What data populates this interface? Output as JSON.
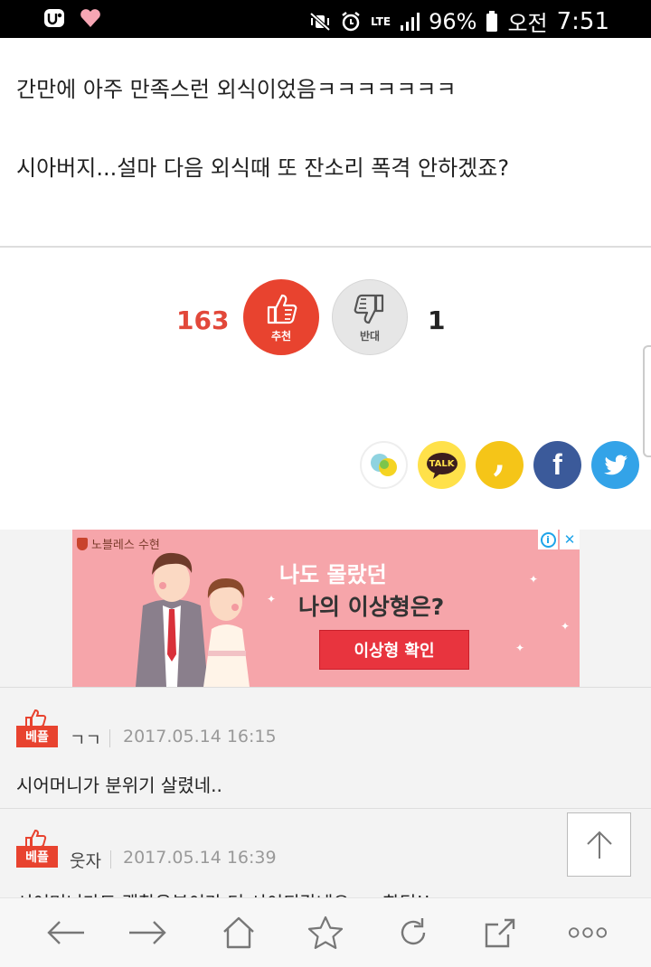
{
  "status_bar": {
    "lte": "LTE",
    "battery": "96%",
    "ampm": "오전",
    "time": "7:51"
  },
  "article": {
    "line1": "간만에 아주 만족스런 외식이었음ㅋㅋㅋㅋㅋㅋㅋ",
    "line2": "시아버지...설마 다음 외식때 또 잔소리 폭격 안하겠죠?"
  },
  "vote": {
    "up_count": "163",
    "up_label": "추천",
    "down_count": "1",
    "down_label": "반대"
  },
  "share": {
    "talk_label": "TALK",
    "story_label": ",",
    "facebook_label": "f"
  },
  "ad": {
    "brand": "노블레스 수현",
    "title1": "나도 몰랐던",
    "title2": "나의 이상형은?",
    "cta": "이상형 확인",
    "info_icon": "i",
    "close_icon": "✕"
  },
  "comments": [
    {
      "badge": "베플",
      "author": "ㄱㄱ",
      "date": "2017.05.14 16:15",
      "text": "시어머니가 분위기 살렸네.."
    },
    {
      "badge": "베플",
      "author": "웃자",
      "date": "2017.05.14 16:39",
      "text": "시어머니가도 괜찮은분이라 더 시이되갔네요ㅋㅋ화팅!!"
    }
  ],
  "colors": {
    "accent": "#e8432f",
    "facebook": "#3b5a9a",
    "twitter": "#33a3e8",
    "kakao": "#ffe14a"
  }
}
